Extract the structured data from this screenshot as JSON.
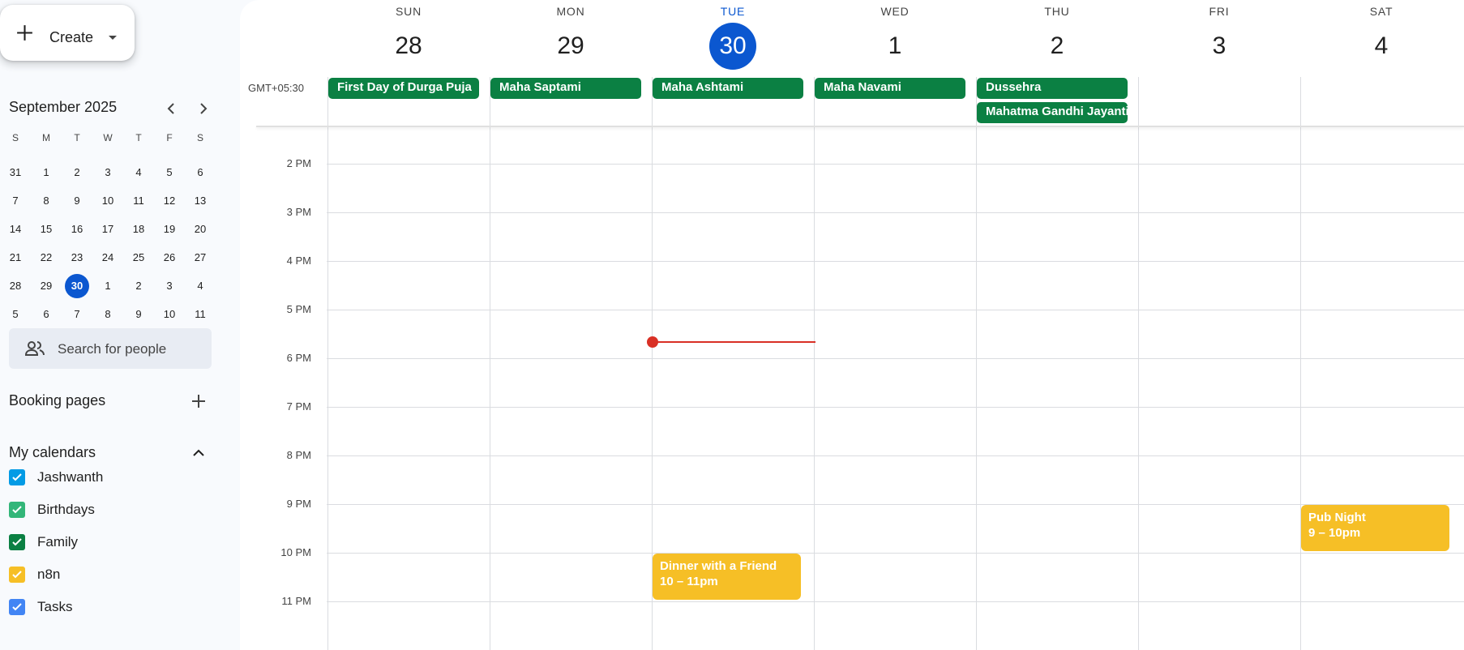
{
  "sidebar": {
    "create_label": "Create",
    "mini_calendar": {
      "title": "September 2025",
      "weekdays": [
        "S",
        "M",
        "T",
        "W",
        "T",
        "F",
        "S"
      ],
      "weeks": [
        [
          "31",
          "1",
          "2",
          "3",
          "4",
          "5",
          "6"
        ],
        [
          "7",
          "8",
          "9",
          "10",
          "11",
          "12",
          "13"
        ],
        [
          "14",
          "15",
          "16",
          "17",
          "18",
          "19",
          "20"
        ],
        [
          "21",
          "22",
          "23",
          "24",
          "25",
          "26",
          "27"
        ],
        [
          "28",
          "29",
          "30",
          "1",
          "2",
          "3",
          "4"
        ],
        [
          "5",
          "6",
          "7",
          "8",
          "9",
          "10",
          "11"
        ]
      ],
      "today": "30"
    },
    "search_people_placeholder": "Search for people",
    "booking_pages_label": "Booking pages",
    "my_calendars_label": "My calendars",
    "calendars": [
      {
        "name": "Jashwanth",
        "color": "#039be5"
      },
      {
        "name": "Birthdays",
        "color": "#33b679"
      },
      {
        "name": "Family",
        "color": "#0b8043"
      },
      {
        "name": "n8n",
        "color": "#f6bf26"
      },
      {
        "name": "Tasks",
        "color": "#4285f4"
      }
    ]
  },
  "week": {
    "days": [
      {
        "dow": "SUN",
        "num": "28"
      },
      {
        "dow": "MON",
        "num": "29"
      },
      {
        "dow": "TUE",
        "num": "30"
      },
      {
        "dow": "WED",
        "num": "1"
      },
      {
        "dow": "THU",
        "num": "2"
      },
      {
        "dow": "FRI",
        "num": "3"
      },
      {
        "dow": "SAT",
        "num": "4"
      }
    ],
    "today_dow": "TUE",
    "timezone": "GMT+05:30",
    "all_day_events": [
      {
        "title": "First Day of Durga Puja",
        "day": "SUN"
      },
      {
        "title": "Maha Saptami",
        "day": "MON"
      },
      {
        "title": "Maha Ashtami",
        "day": "TUE"
      },
      {
        "title": "Maha Navami",
        "day": "WED"
      },
      {
        "title": "Dussehra",
        "day": "THU"
      },
      {
        "title": "Mahatma Gandhi Jayanti",
        "day": "THU"
      }
    ],
    "hours": [
      "2 PM",
      "3 PM",
      "4 PM",
      "5 PM",
      "6 PM",
      "7 PM",
      "8 PM",
      "9 PM",
      "10 PM",
      "11 PM"
    ],
    "events": [
      {
        "title": "Dinner with a Friend",
        "time": "10 – 11pm",
        "day": "TUE"
      },
      {
        "title": "Pub Night",
        "time": "9 – 10pm",
        "day": "SAT"
      }
    ],
    "event_color": "#f6bf26",
    "all_day_color": "#0b8043"
  }
}
